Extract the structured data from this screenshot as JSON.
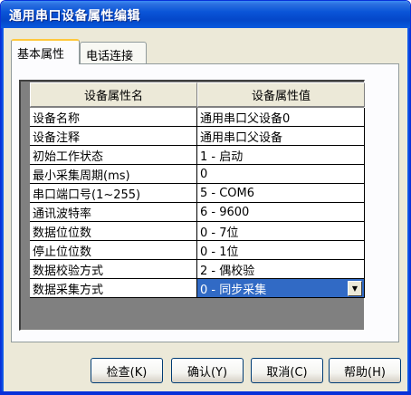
{
  "window": {
    "title": "通用串口设备属性编辑"
  },
  "tabs": [
    {
      "label": "基本属性",
      "active": true
    },
    {
      "label": "电话连接",
      "active": false
    }
  ],
  "grid": {
    "headers": [
      "设备属性名",
      "设备属性值"
    ],
    "rows": [
      {
        "name": "设备名称",
        "value": "通用串口父设备0"
      },
      {
        "name": "设备注释",
        "value": "通用串口父设备"
      },
      {
        "name": "初始工作状态",
        "value": "1 - 启动"
      },
      {
        "name": "最小采集周期(ms)",
        "value": "0"
      },
      {
        "name": "串口端口号(1~255)",
        "value": "5 - COM6"
      },
      {
        "name": "通讯波特率",
        "value": "6 - 9600"
      },
      {
        "name": "数据位位数",
        "value": "0 - 7位"
      },
      {
        "name": "停止位位数",
        "value": "0 - 1位"
      },
      {
        "name": "数据校验方式",
        "value": "2 - 偶校验"
      },
      {
        "name": "数据采集方式",
        "value": "0 - 同步采集"
      }
    ],
    "selected_row": 9
  },
  "buttons": {
    "check": "检查(K)",
    "confirm": "确认(Y)",
    "cancel": "取消(C)",
    "help": "帮助(H)"
  },
  "icons": {
    "combo": "chevron-down-icon"
  },
  "colors": {
    "title_bar": "#0a55d8",
    "selection": "#316ac5",
    "window_bg": "#ece9d8"
  }
}
